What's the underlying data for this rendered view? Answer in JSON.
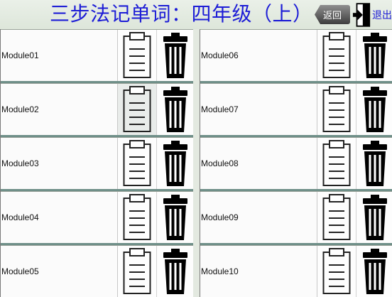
{
  "header": {
    "title": "三步法记单词：四年级（上）",
    "back_label": "返回",
    "exit_label": "退出"
  },
  "modules": {
    "left": [
      {
        "label": "Module01"
      },
      {
        "label": "Module02"
      },
      {
        "label": "Module03"
      },
      {
        "label": "Module04"
      },
      {
        "label": "Module05"
      }
    ],
    "right": [
      {
        "label": "Module06"
      },
      {
        "label": "Module07"
      },
      {
        "label": "Module08"
      },
      {
        "label": "Module09"
      },
      {
        "label": "Module10"
      }
    ]
  },
  "icons": {
    "edit": "clipboard-icon",
    "delete": "trash-icon",
    "exit": "exit-door-icon"
  },
  "colors": {
    "title": "#1d1dd6",
    "background": "#e3e9e0"
  }
}
